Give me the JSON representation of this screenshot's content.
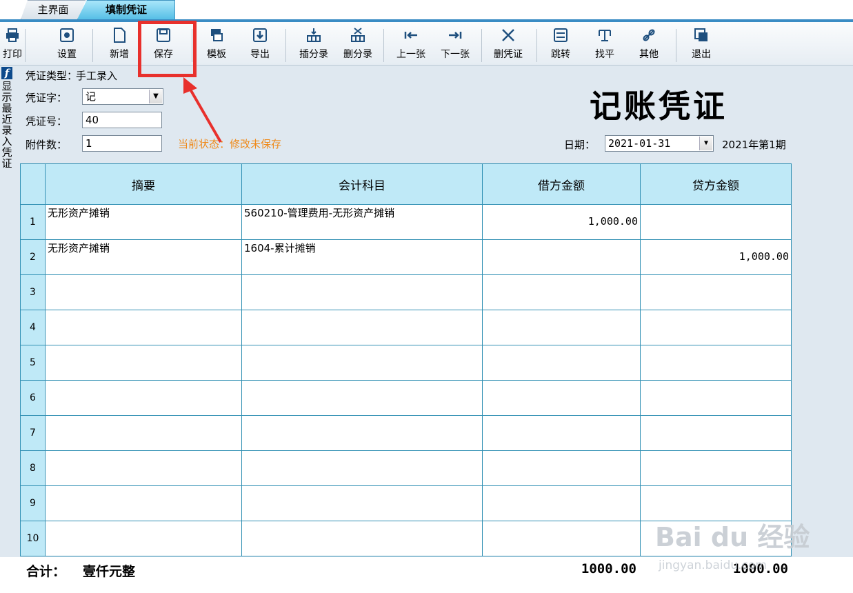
{
  "tabs": {
    "main": "主界面",
    "voucher": "填制凭证"
  },
  "toolbar": [
    {
      "label": "打印",
      "icon": "printer-icon"
    },
    {
      "label": "设置",
      "icon": "settings-icon"
    },
    {
      "label": "新增",
      "icon": "new-document-icon"
    },
    {
      "label": "保存",
      "icon": "save-icon"
    },
    {
      "label": "模板",
      "icon": "template-icon"
    },
    {
      "label": "导出",
      "icon": "export-icon"
    },
    {
      "label": "插分录",
      "icon": "insert-row-icon"
    },
    {
      "label": "删分录",
      "icon": "delete-row-icon"
    },
    {
      "label": "上一张",
      "icon": "previous-icon"
    },
    {
      "label": "下一张",
      "icon": "next-icon"
    },
    {
      "label": "删凭证",
      "icon": "delete-voucher-icon"
    },
    {
      "label": "跳转",
      "icon": "jump-icon"
    },
    {
      "label": "找平",
      "icon": "balance-icon"
    },
    {
      "label": "其他",
      "icon": "link-icon"
    },
    {
      "label": "退出",
      "icon": "exit-icon"
    }
  ],
  "sidebar": {
    "badge": "f",
    "label": "显示最近录入凭证"
  },
  "header": {
    "voucher_type_label": "凭证类型：",
    "voucher_type_value": "手工录入",
    "voucher_word_label": "凭证字：",
    "voucher_word_value": "记",
    "voucher_no_label": "凭证号：",
    "voucher_no_value": "40",
    "attachments_label": "附件数：",
    "attachments_value": "1",
    "status": "当前状态：修改未保存",
    "title": "记账凭证",
    "date_label": "日期：",
    "date_value": "2021-01-31",
    "period": "2021年第1期"
  },
  "table": {
    "columns": [
      "摘要",
      "会计科目",
      "借方金额",
      "贷方金额"
    ],
    "rows": [
      {
        "no": "1",
        "summary": "无形资产摊销",
        "account": "560210-管理费用-无形资产摊销",
        "debit": "1,000.00",
        "credit": ""
      },
      {
        "no": "2",
        "summary": "无形资产摊销",
        "account": "1604-累计摊销",
        "debit": "",
        "credit": "1,000.00"
      },
      {
        "no": "3",
        "summary": "",
        "account": "",
        "debit": "",
        "credit": ""
      },
      {
        "no": "4",
        "summary": "",
        "account": "",
        "debit": "",
        "credit": ""
      },
      {
        "no": "5",
        "summary": "",
        "account": "",
        "debit": "",
        "credit": ""
      },
      {
        "no": "6",
        "summary": "",
        "account": "",
        "debit": "",
        "credit": ""
      },
      {
        "no": "7",
        "summary": "",
        "account": "",
        "debit": "",
        "credit": ""
      },
      {
        "no": "8",
        "summary": "",
        "account": "",
        "debit": "",
        "credit": ""
      },
      {
        "no": "9",
        "summary": "",
        "account": "",
        "debit": "",
        "credit": ""
      },
      {
        "no": "10",
        "summary": "",
        "account": "",
        "debit": "",
        "credit": ""
      }
    ]
  },
  "totals": {
    "label": "合计：",
    "amount_words": "壹仟元整",
    "debit": "1000.00",
    "credit": "1000.00"
  },
  "watermark": {
    "brand": "Bai du 经验",
    "sub": "jingyan.baidu.com"
  },
  "colors": {
    "accent": "#3a8cc4",
    "header_cell": "#bfe9f7",
    "grid_line": "#2f8fb3",
    "status": "#ef8a1a",
    "highlight": "#e8302c"
  }
}
